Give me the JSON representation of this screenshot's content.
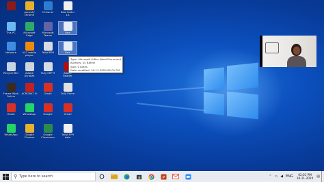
{
  "desktop_icons": [
    {
      "name": "winrar",
      "label": "",
      "color": "#8b1a1a"
    },
    {
      "name": "chrome",
      "label": "ganesh/ chrome",
      "color": "#e8b12c"
    },
    {
      "name": "ccleaner",
      "label": "CCleaner",
      "color": "#2c7dd1"
    },
    {
      "name": "file",
      "label": "New folder 1A",
      "color": "#f0f0f0"
    },
    {
      "name": "this-pc",
      "label": "This PC",
      "color": "#6cb8f0"
    },
    {
      "name": "edge",
      "label": "Microsoft Edge",
      "color": "#2fa86a"
    },
    {
      "name": "multiplayer",
      "label": "Microsoft Teams",
      "color": "#6264a7"
    },
    {
      "name": "doc-1",
      "label": "New",
      "color": "#e6eef8"
    },
    {
      "name": "network",
      "label": "Network",
      "color": "#3f8de0"
    },
    {
      "name": "vlc",
      "label": "VLC media player",
      "color": "#f08a0c"
    },
    {
      "name": "tally",
      "label": "TallyERP9",
      "color": "#d7dbe2"
    },
    {
      "name": "doc-2",
      "label": "New",
      "color": "#e6eef8"
    },
    {
      "name": "recycle-bin",
      "label": "Recycle Bin",
      "color": "#c8d4e2"
    },
    {
      "name": "acrobat",
      "label": "Adobe Acrobat",
      "color": "#d0d4da"
    },
    {
      "name": "tally-edu",
      "label": "Tally ERP 9",
      "color": "#d7dbe2"
    },
    {
      "name": "pdf",
      "label": "Adobe Reader",
      "color": "#b80c0c"
    },
    {
      "name": "fuel",
      "label": "Frame Work Online",
      "color": "#3a2b20"
    },
    {
      "name": "acrobat-2",
      "label": "ACROBAT XI",
      "color": "#c32020"
    },
    {
      "name": "gmail",
      "label": "Gmail",
      "color": "#d93025"
    },
    {
      "name": "dvd",
      "label": "Tally Prime",
      "color": "#e0e0e0"
    },
    {
      "name": "gmail-2",
      "label": "Gmail",
      "color": "#d93025"
    },
    {
      "name": "whatsapp",
      "label": "WhatsApp",
      "color": "#25d366"
    },
    {
      "name": "google",
      "label": "Google",
      "color": "#d93025"
    },
    {
      "name": "gmail-3",
      "label": "Gmail",
      "color": "#d93025"
    },
    {
      "name": "whatsapp-2",
      "label": "WhatsApp",
      "color": "#25d366"
    },
    {
      "name": "chrome-2",
      "label": "Google Chrome",
      "color": "#e8b12c"
    },
    {
      "name": "google-slides",
      "label": "Google Classroom",
      "color": "#2d8a4b"
    },
    {
      "name": "file-3",
      "label": "TallyERP9 data",
      "color": "#f0f0f0"
    }
  ],
  "tooltip": {
    "type": "Type: Microsoft Office Word Document",
    "authors": "Authors: UL Bahrill",
    "size": "Size: 0 bytes",
    "date": "Date modified: 30-11-2020 02:01 PM"
  },
  "taskbar": {
    "search_placeholder": "Type here to search",
    "time": "02:01 PM",
    "date": "30-11-2020",
    "lang": "ENG"
  },
  "colors": {
    "desktop": "#0b4fbd",
    "taskbar": "#e8ebf0"
  }
}
